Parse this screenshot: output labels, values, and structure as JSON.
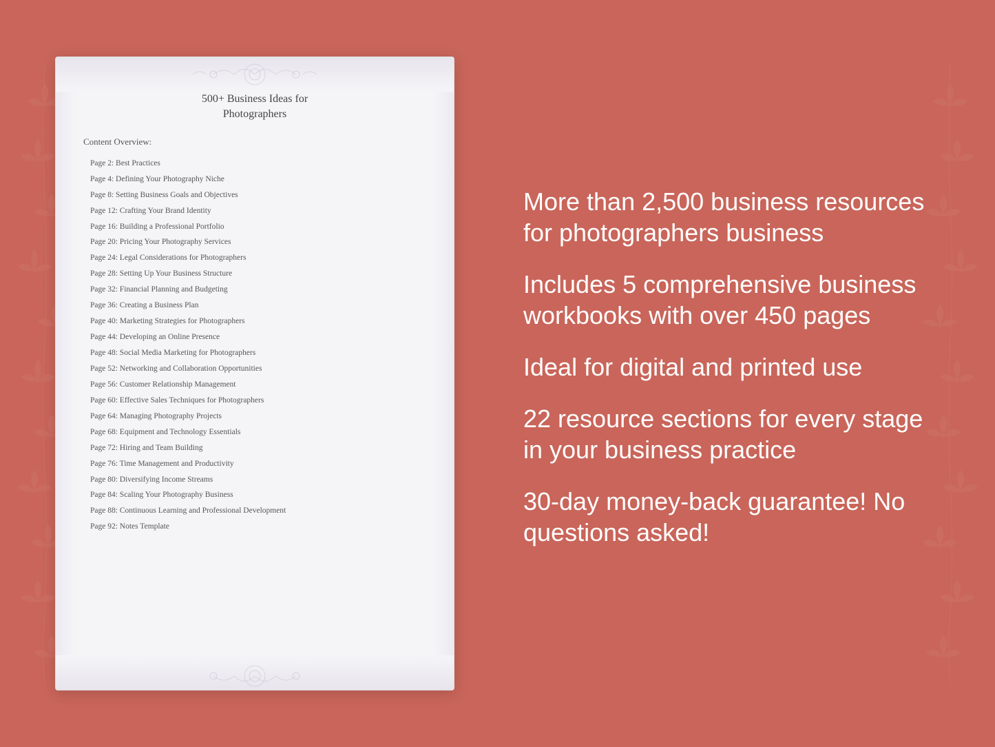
{
  "background_color": "#c9655a",
  "document": {
    "title_line1": "500+ Business Ideas for",
    "title_line2": "Photographers",
    "section_heading": "Content Overview:",
    "toc_items": [
      {
        "page": "Page  2:",
        "title": "Best Practices"
      },
      {
        "page": "Page  4:",
        "title": "Defining Your Photography Niche"
      },
      {
        "page": "Page  8:",
        "title": "Setting Business Goals and Objectives"
      },
      {
        "page": "Page 12:",
        "title": "Crafting Your Brand Identity"
      },
      {
        "page": "Page 16:",
        "title": "Building a Professional Portfolio"
      },
      {
        "page": "Page 20:",
        "title": "Pricing Your Photography Services"
      },
      {
        "page": "Page 24:",
        "title": "Legal Considerations for Photographers"
      },
      {
        "page": "Page 28:",
        "title": "Setting Up Your Business Structure"
      },
      {
        "page": "Page 32:",
        "title": "Financial Planning and Budgeting"
      },
      {
        "page": "Page 36:",
        "title": "Creating a Business Plan"
      },
      {
        "page": "Page 40:",
        "title": "Marketing Strategies for Photographers"
      },
      {
        "page": "Page 44:",
        "title": "Developing an Online Presence"
      },
      {
        "page": "Page 48:",
        "title": "Social Media Marketing for Photographers"
      },
      {
        "page": "Page 52:",
        "title": "Networking and Collaboration Opportunities"
      },
      {
        "page": "Page 56:",
        "title": "Customer Relationship Management"
      },
      {
        "page": "Page 60:",
        "title": "Effective Sales Techniques for Photographers"
      },
      {
        "page": "Page 64:",
        "title": "Managing Photography Projects"
      },
      {
        "page": "Page 68:",
        "title": "Equipment and Technology Essentials"
      },
      {
        "page": "Page 72:",
        "title": "Hiring and Team Building"
      },
      {
        "page": "Page 76:",
        "title": "Time Management and Productivity"
      },
      {
        "page": "Page 80:",
        "title": "Diversifying Income Streams"
      },
      {
        "page": "Page 84:",
        "title": "Scaling Your Photography Business"
      },
      {
        "page": "Page 88:",
        "title": "Continuous Learning and Professional Development"
      },
      {
        "page": "Page 92:",
        "title": "Notes Template"
      }
    ]
  },
  "features": [
    "More than 2,500 business resources for photographers business",
    "Includes 5 comprehensive business workbooks with over 450 pages",
    "Ideal for digital and printed use",
    "22 resource sections for every stage in your business practice",
    "30-day money-back guarantee! No questions asked!"
  ]
}
